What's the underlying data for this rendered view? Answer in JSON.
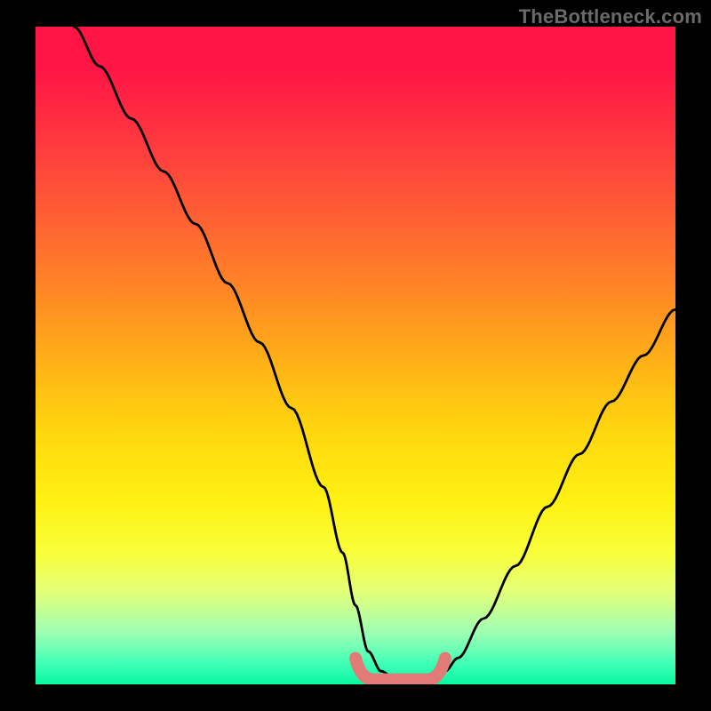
{
  "attribution": "TheBottleneck.com",
  "chart_data": {
    "type": "line",
    "title": "",
    "xlabel": "",
    "ylabel": "",
    "xlim": [
      0,
      100
    ],
    "ylim": [
      0,
      100
    ],
    "series": [
      {
        "name": "bottleneck-curve",
        "x": [
          6,
          10,
          15,
          20,
          25,
          30,
          35,
          40,
          45,
          48,
          50,
          52,
          54,
          56,
          58,
          60,
          62,
          64,
          66,
          70,
          75,
          80,
          85,
          90,
          95,
          100
        ],
        "y": [
          100,
          94,
          86,
          78,
          70,
          61,
          52,
          42,
          30,
          20,
          12,
          5,
          2,
          1,
          1,
          1,
          1,
          2,
          4,
          10,
          18,
          27,
          35,
          43,
          50,
          57
        ]
      }
    ],
    "marker": {
      "name": "optimal-range-marker",
      "color": "#e27a78",
      "x_start": 50,
      "x_end": 64,
      "y": 1
    },
    "background_gradient": {
      "top": "#ff1446",
      "mid": "#ffe512",
      "bottom": "#08f7a1"
    }
  }
}
